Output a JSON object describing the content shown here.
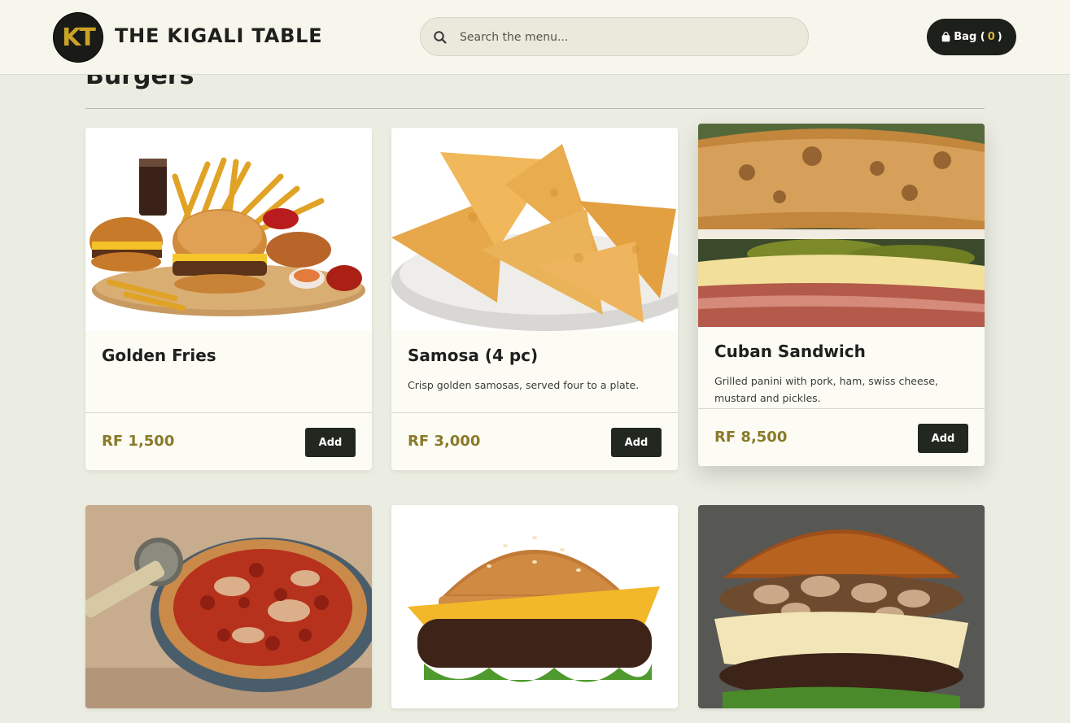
{
  "header": {
    "logo_text": "KT",
    "brand": "THE KIGALI TABLE",
    "search_placeholder": "Search the menu...",
    "bag_label": "Bag (",
    "bag_count": "0",
    "bag_close": ")"
  },
  "section": {
    "title": "Burgers"
  },
  "cards": [
    {
      "name": "Golden Fries",
      "description": "",
      "price": "RF 1,500",
      "add_label": "Add",
      "image": "fries-burger-combo"
    },
    {
      "name": "Samosa (4 pc)",
      "description": "Crisp golden samosas, served four to a plate.",
      "price": "RF 3,000",
      "add_label": "Add",
      "image": "samosa-plate"
    },
    {
      "name": "Cuban Sandwich",
      "description": "Grilled panini with pork, ham, swiss cheese, mustard and pickles.",
      "price": "RF 8,500",
      "add_label": "Add",
      "image": "cuban-sandwich"
    },
    {
      "name": "",
      "description": "",
      "price": "",
      "add_label": "",
      "image": "pepperoni-pizza"
    },
    {
      "name": "",
      "description": "",
      "price": "",
      "add_label": "",
      "image": "cheeseburger"
    },
    {
      "name": "",
      "description": "",
      "price": "",
      "add_label": "",
      "image": "mushroom-burger"
    }
  ],
  "colors": {
    "accent": "#c9a227",
    "price": "#8a7a29",
    "button": "#22281f",
    "page_bg": "#ecede2"
  }
}
